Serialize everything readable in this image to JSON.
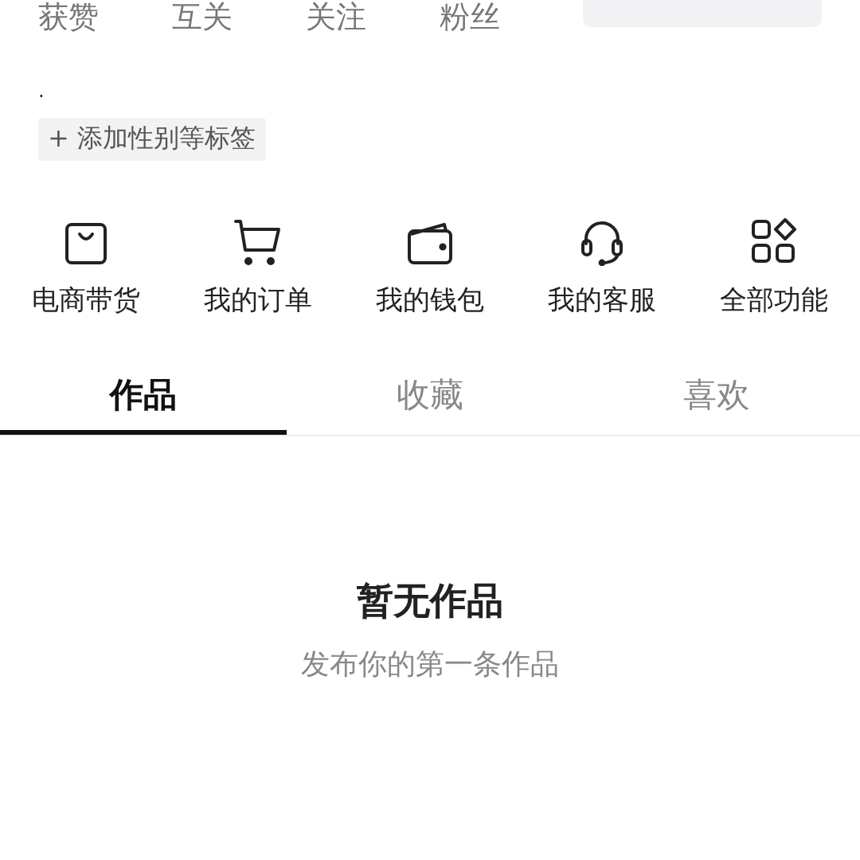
{
  "stats": [
    {
      "label": "获赞"
    },
    {
      "label": "互关"
    },
    {
      "label": "关注"
    },
    {
      "label": "粉丝"
    }
  ],
  "bio": ".",
  "tag_button": {
    "icon": "+",
    "label": "添加性别等标签"
  },
  "shortcuts": [
    {
      "kind": "bag",
      "label": "电商带货"
    },
    {
      "kind": "cart",
      "label": "我的订单"
    },
    {
      "kind": "wallet",
      "label": "我的钱包"
    },
    {
      "kind": "headset",
      "label": "我的客服"
    },
    {
      "kind": "grid",
      "label": "全部功能"
    }
  ],
  "tabs": [
    {
      "label": "作品",
      "selected": true
    },
    {
      "label": "收藏",
      "selected": false
    },
    {
      "label": "喜欢",
      "selected": false
    }
  ],
  "empty_state": {
    "title": "暂无作品",
    "subtitle": "发布你的第一条作品"
  }
}
